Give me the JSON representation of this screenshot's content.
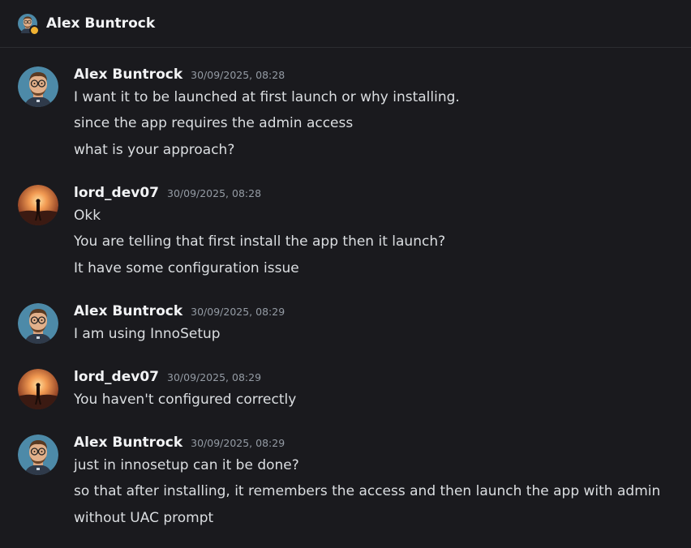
{
  "header": {
    "title": "Alex Buntrock",
    "status_color": "#f0b232"
  },
  "messages": [
    {
      "author": "Alex Buntrock",
      "avatar": "man-with-glasses-avatar",
      "timestamp": "30/09/2025, 08:28",
      "lines": [
        "I want it to be launched at first launch or why installing.",
        "since the app requires the admin access",
        "what is your approach?"
      ]
    },
    {
      "author": "lord_dev07",
      "avatar": "sunset-wanderer-avatar",
      "timestamp": "30/09/2025, 08:28",
      "lines": [
        "Okk",
        "You are telling that first install the app then it launch?",
        "It have some configuration issue"
      ]
    },
    {
      "author": "Alex Buntrock",
      "avatar": "man-with-glasses-avatar",
      "timestamp": "30/09/2025, 08:29",
      "lines": [
        "I am using InnoSetup"
      ]
    },
    {
      "author": "lord_dev07",
      "avatar": "sunset-wanderer-avatar",
      "timestamp": "30/09/2025, 08:29",
      "lines": [
        "You haven't configured correctly"
      ]
    },
    {
      "author": "Alex Buntrock",
      "avatar": "man-with-glasses-avatar",
      "timestamp": "30/09/2025, 08:29",
      "lines": [
        "just in innosetup can it be done?",
        "so that after installing, it remembers the access and then launch the app with admin",
        "without UAC prompt"
      ]
    }
  ]
}
